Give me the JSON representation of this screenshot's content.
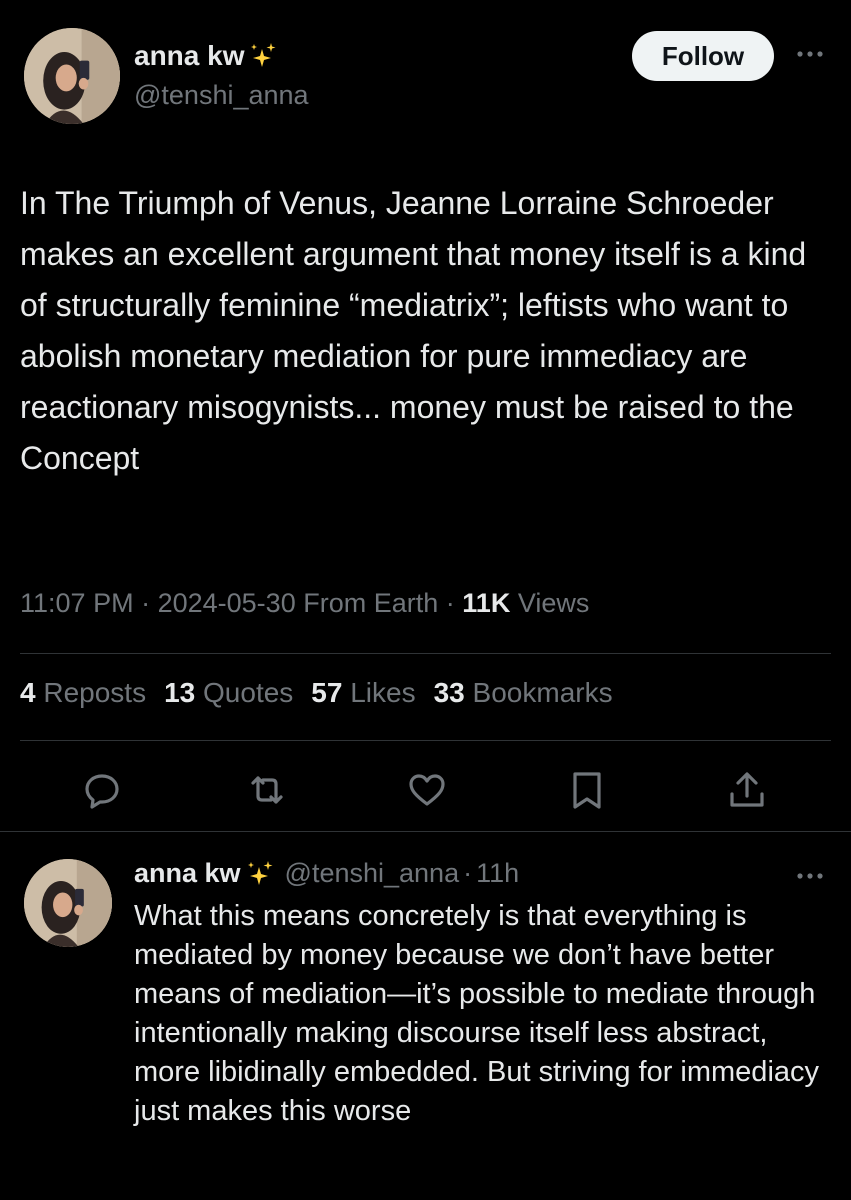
{
  "tweet": {
    "author_name": "anna kw",
    "author_handle": "@tenshi_anna",
    "follow_label": "Follow",
    "text": "In The Triumph of Venus, Jeanne Lorraine Schroeder makes an excellent argument that money itself is a kind of structurally feminine “mediatrix”; leftists who want to abolish monetary mediation for pure immediacy are reactionary misogynists... money must be raised to the Concept",
    "time": "11:07 PM",
    "date": "2024-05-30",
    "source": "From Earth",
    "views_count": "11K",
    "views_label": "Views",
    "stats": [
      {
        "count": "4",
        "label": "Reposts"
      },
      {
        "count": "13",
        "label": "Quotes"
      },
      {
        "count": "57",
        "label": "Likes"
      },
      {
        "count": "33",
        "label": "Bookmarks"
      }
    ]
  },
  "actions": [
    "reply-icon",
    "repost-icon",
    "like-icon",
    "bookmark-icon",
    "share-icon"
  ],
  "reply": {
    "author_name": "anna kw",
    "author_handle": "@tenshi_anna",
    "age": "11h",
    "text": "What this means concretely is that everything is mediated by money because we don’t have better means of mediation—it’s possible to mediate through intentionally making discourse itself less abstract, more libidinally embedded. But striving for immediacy just makes this worse"
  },
  "colors": {
    "background": "#000000",
    "text_primary": "#e7e9ea",
    "text_secondary": "#71767b",
    "divider": "#2f3336",
    "follow_bg": "#eff3f4",
    "sparkle": "#ffd23f"
  }
}
